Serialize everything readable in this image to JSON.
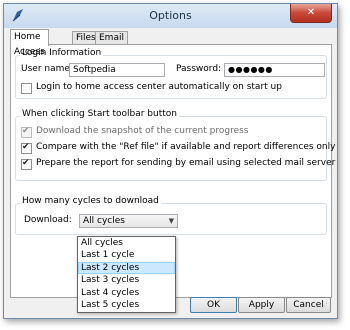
{
  "window": {
    "title": "Options",
    "close_glyph": "✕",
    "icon": "feather-icon"
  },
  "tabs": [
    {
      "label": "Home Access",
      "active": true
    },
    {
      "label": "Files",
      "active": false
    },
    {
      "label": "Email",
      "active": false
    }
  ],
  "login": {
    "group_title": "Login Information",
    "username_label": "User name:",
    "username_value": "Softpedia",
    "password_label": "Password:",
    "password_value": "●●●●●●",
    "auto_login_label": "Login to home access center automatically on start up",
    "auto_login_checked": false
  },
  "toolbar": {
    "group_title": "When clicking Start toolbar button",
    "options": [
      {
        "label": "Download the snapshot of the current progress",
        "checked": true,
        "enabled": false
      },
      {
        "label": "Compare with the \"Ref file\" if available and report differences only",
        "checked": true,
        "enabled": true
      },
      {
        "label": "Prepare the report for sending by email using selected mail server",
        "checked": true,
        "enabled": true
      }
    ]
  },
  "cycles": {
    "group_title": "How many cycles to download",
    "download_label": "Download:",
    "selected": "All cycles",
    "options": [
      "All cycles",
      "Last 1 cycle",
      "Last 2 cycles",
      "Last 3 cycles",
      "Last 4 cycles",
      "Last 5 cycles"
    ],
    "highlighted": "Last 2 cycles"
  },
  "buttons": {
    "ok": "OK",
    "apply": "Apply",
    "cancel": "Cancel"
  }
}
